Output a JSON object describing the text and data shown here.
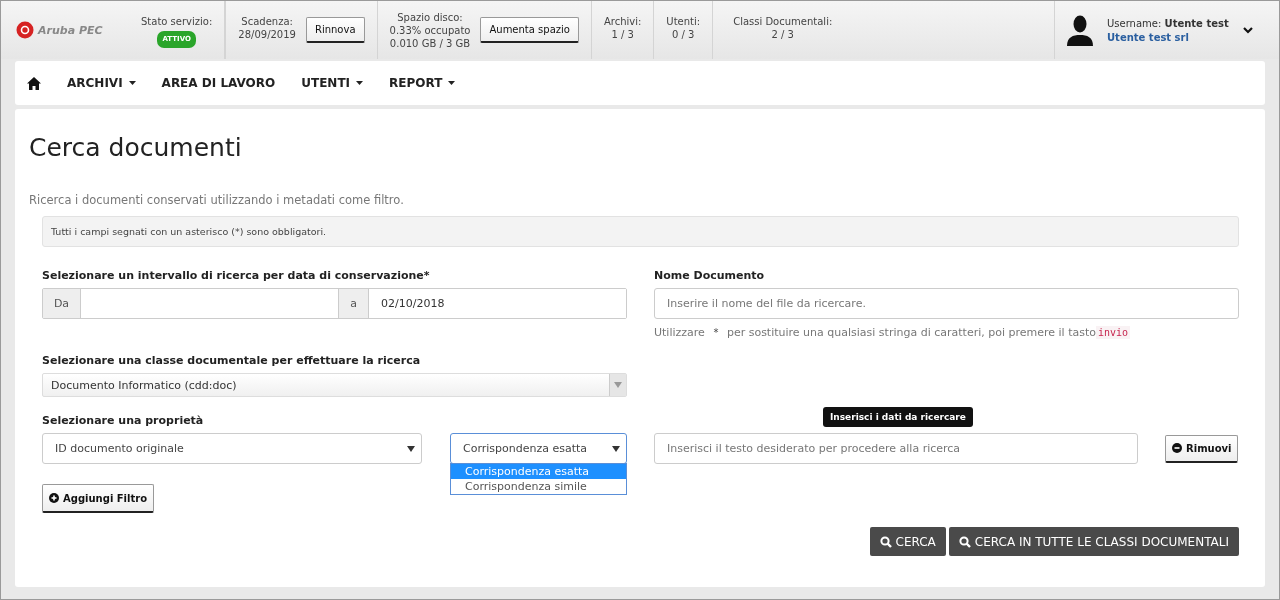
{
  "header": {
    "logo": "Aruba PEC",
    "status": {
      "label": "Stato servizio:",
      "badge": "ATTIVO",
      "active": true
    },
    "expiry": {
      "label": "Scadenza:",
      "value": "28/09/2019",
      "button": "Rinnova"
    },
    "disk": {
      "label": "Spazio disco:",
      "used": "0.33% occupato",
      "amount": "0.010 GB / 3 GB",
      "button": "Aumenta spazio"
    },
    "counters": [
      {
        "label": "Archivi:",
        "value": "1 / 3"
      },
      {
        "label": "Utenti:",
        "value": "0 / 3"
      },
      {
        "label": "Classi Documentali:",
        "value": "2 / 3"
      }
    ],
    "user": {
      "username": "Username: **Utente test**",
      "company": "Utente test srl"
    }
  },
  "nav": [
    {
      "kind": "home"
    },
    {
      "kind": "dropdown",
      "label": "ARCHIVI"
    },
    {
      "kind": "link",
      "label": "AREA DI LAVORO"
    },
    {
      "kind": "dropdown",
      "label": "UTENTI"
    },
    {
      "kind": "dropdown",
      "label": "REPORT"
    }
  ],
  "page": {
    "title": "Cerca documenti",
    "intro": "Ricerca i documenti conservati utilizzando i metadati come filtro.",
    "notice": "Tutti i campi segnati con un asterisco (*) sono obbligatori.",
    "date_range": {
      "label": "Selezionare un intervallo di ricerca per data di conservazione*",
      "from_label": "Da",
      "to_label": "a",
      "to_value": "02/10/2018"
    },
    "document_name": {
      "label": "Nome Documento",
      "placeholder": "Inserire il nome del file da ricercare.",
      "hint_before": "Utilizzare",
      "hint_mark": "*",
      "hint_after": "per sostituire una qualsiasi stringa di caratteri, poi premere il tasto",
      "hint_key": "invio"
    },
    "document_class": {
      "label": "Selezionare una classe documentale per effettuare la ricerca",
      "value": "Documento Informatico (cdd:doc)"
    },
    "property": {
      "label": "Selezionare una proprietà",
      "value": "ID documento originale",
      "match": "Corrispondenza esatta",
      "match_open": true,
      "match_options": [
        {
          "label": "Corrispondenza esatta",
          "selected": true
        },
        {
          "label": "Corrispondenza simile",
          "selected": false
        }
      ],
      "tooltip": "Inserisci i dati da ricercare",
      "placeholder": "Inserisci il testo desiderato per procedere alla ricerca",
      "remove": "Rimuovi"
    },
    "add_filter": "Aggiungi Filtro",
    "actions": [
      "CERCA",
      "CERCA IN TUTTE LE CLASSI DOCUMENTALI"
    ]
  }
}
